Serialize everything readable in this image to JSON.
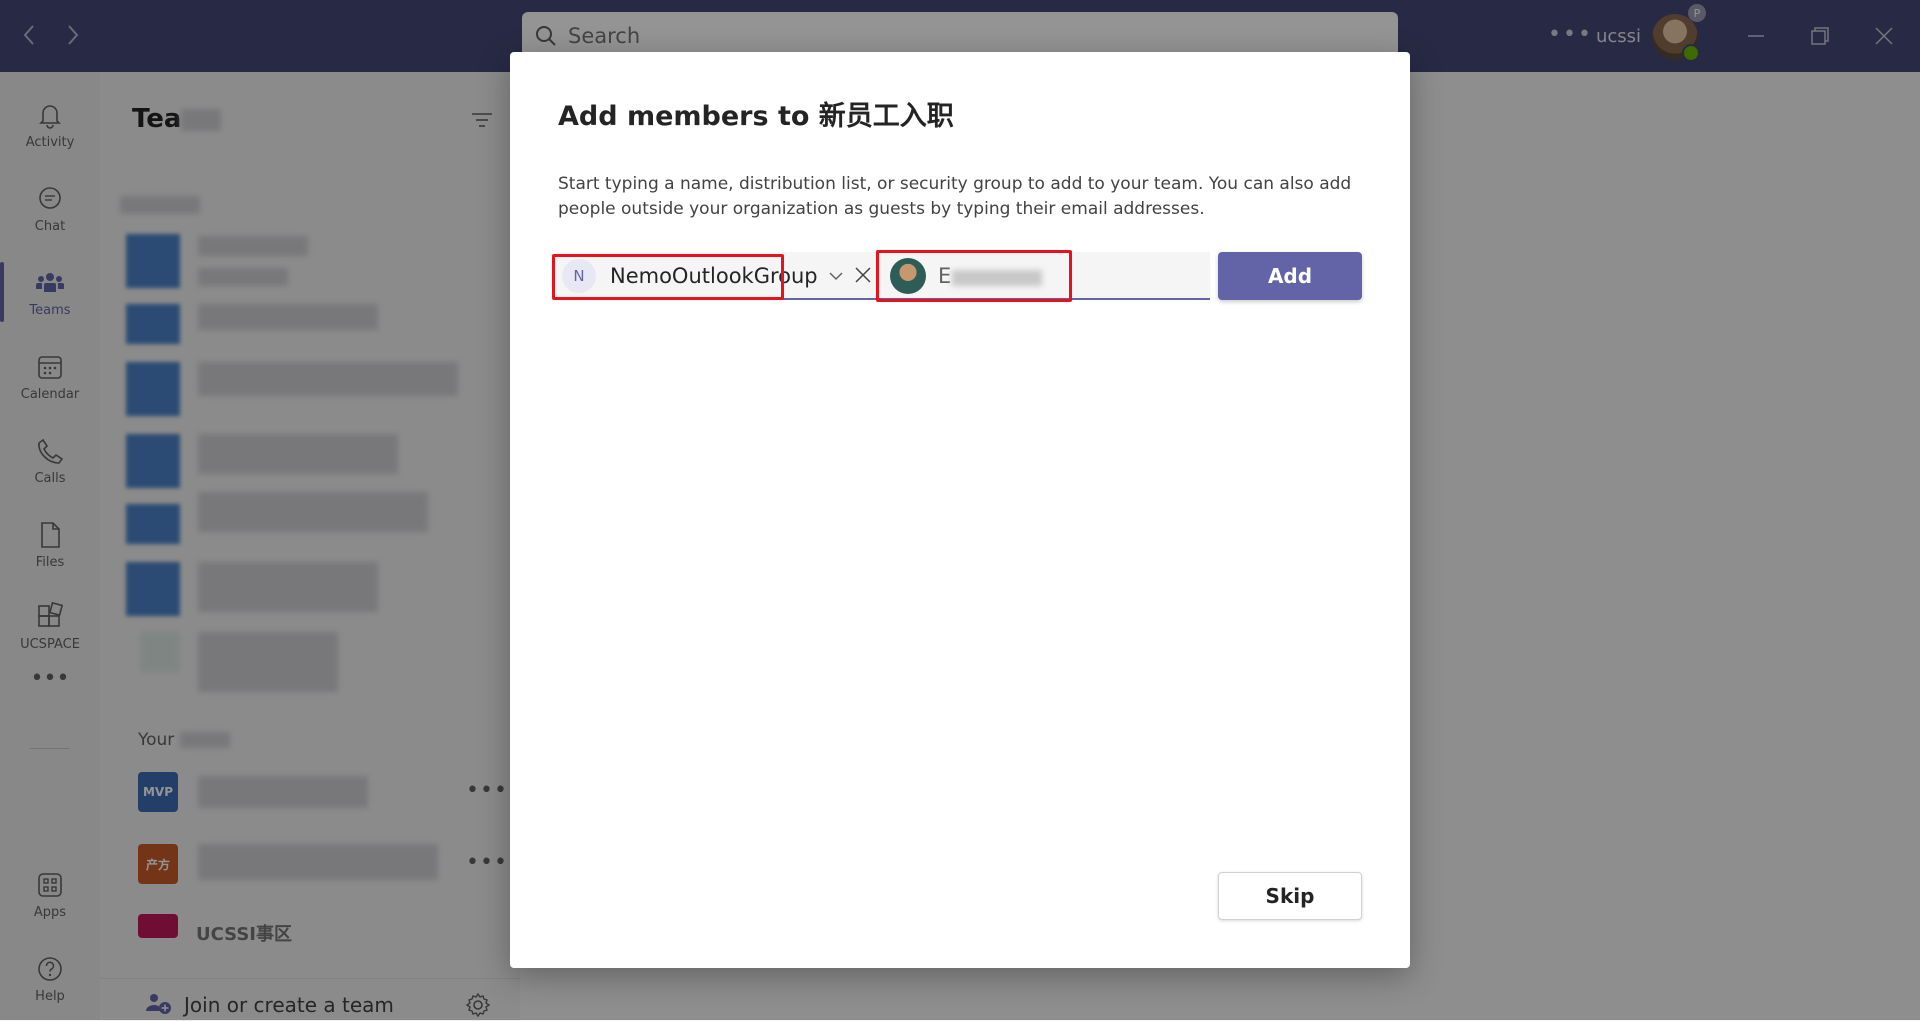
{
  "titlebar": {
    "search_placeholder": "Search",
    "user_name": "ucssi",
    "avatar_badge": "P"
  },
  "rail": {
    "items": [
      {
        "label": "Activity",
        "icon": "bell-icon"
      },
      {
        "label": "Chat",
        "icon": "chat-icon"
      },
      {
        "label": "Teams",
        "icon": "teams-icon",
        "active": true
      },
      {
        "label": "Calendar",
        "icon": "calendar-icon"
      },
      {
        "label": "Calls",
        "icon": "phone-icon"
      },
      {
        "label": "Files",
        "icon": "file-icon"
      },
      {
        "label": "UCSPACE",
        "icon": "apps-grid-icon"
      },
      {
        "label": "Apps",
        "icon": "apps-icon"
      },
      {
        "label": "Help",
        "icon": "help-icon"
      }
    ]
  },
  "pane": {
    "title": "Tea",
    "section_label": "Your",
    "team_mvp_label": "MVP",
    "team_orange_label": "产方",
    "team_visible_name": "UCSSI事区",
    "join_label": "Join or create a team"
  },
  "dialog": {
    "title": "Add members to 新员工入职",
    "description": "Start typing a name, distribution list, or security group to add to your team. You can also add people outside your organization as guests by typing their email addresses.",
    "chip_initial": "N",
    "chip_name": "NemoOutlookGroup",
    "second_entry_text": "E",
    "add_label": "Add",
    "skip_label": "Skip"
  },
  "colors": {
    "titlebar": "#464775",
    "accent": "#6264a7",
    "highlight": "#e8121d"
  }
}
